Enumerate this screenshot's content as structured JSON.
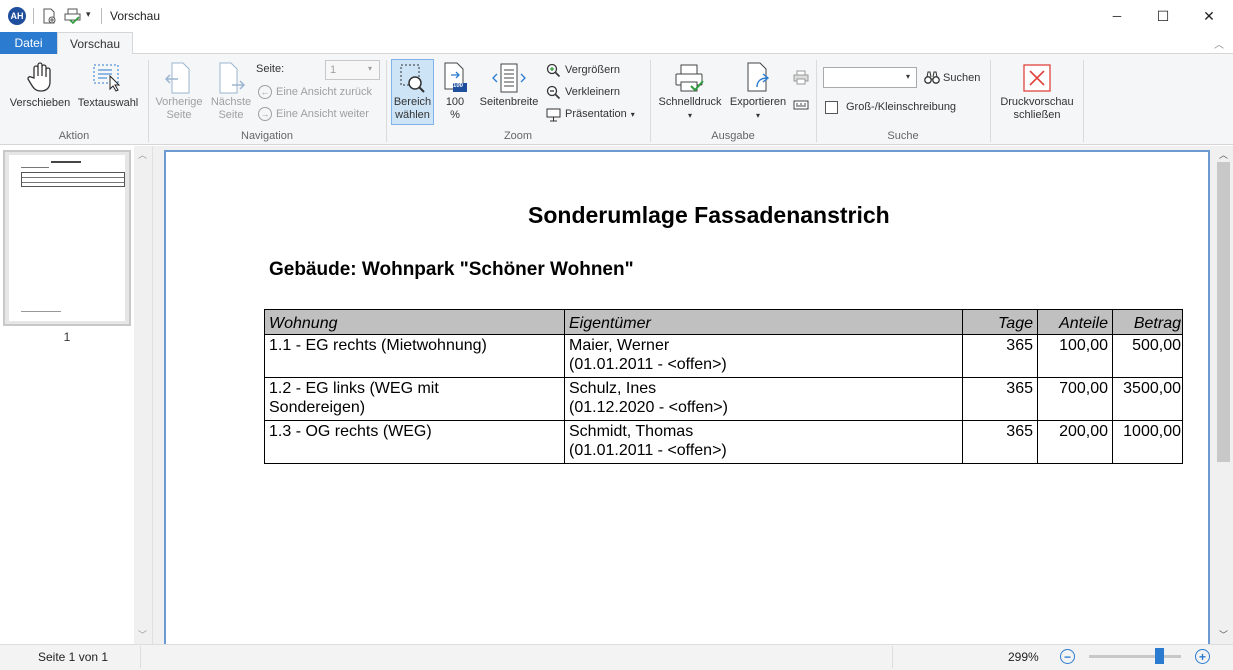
{
  "titlebar": {
    "avatar_initials": "AH",
    "title": "Vorschau",
    "minimize": "─",
    "maximize": "☐",
    "close": "✕"
  },
  "tabs": {
    "file": "Datei",
    "vorschau": "Vorschau"
  },
  "ribbon": {
    "aktion": {
      "label": "Aktion",
      "verschieben": "Verschieben",
      "textauswahl": "Textauswahl"
    },
    "navigation": {
      "label": "Navigation",
      "vorherige_line1": "Vorherige",
      "vorherige_line2": "Seite",
      "naechste_line1": "Nächste",
      "naechste_line2": "Seite",
      "seite_label": "Seite:",
      "seite_value": "1",
      "ansicht_zurueck": "Eine Ansicht zurück",
      "ansicht_weiter": "Eine Ansicht weiter"
    },
    "zoom": {
      "label": "Zoom",
      "bereich_line1": "Bereich",
      "bereich_line2": "wählen",
      "hundert_line1": "100",
      "hundert_line2": "%",
      "hundert_icon_text": "100",
      "seitenbreite": "Seitenbreite",
      "vergroessern": "Vergrößern",
      "verkleinern": "Verkleinern",
      "praesentation": "Präsentation"
    },
    "ausgabe": {
      "label": "Ausgabe",
      "schnelldruck": "Schnelldruck",
      "exportieren": "Exportieren"
    },
    "suche": {
      "label": "Suche",
      "suchen": "Suchen",
      "gross_klein": "Groß-/Kleinschreibung",
      "search_value": ""
    },
    "close_preview": {
      "line1": "Druckvorschau",
      "line2": "schließen"
    }
  },
  "thumbnail": {
    "page_number": "1"
  },
  "document": {
    "title": "Sonderumlage Fassadenanstrich",
    "subtitle": "Gebäude: Wohnpark \"Schöner Wohnen\"",
    "columns": [
      "Wohnung",
      "Eigentümer",
      "Tage",
      "Anteile",
      "Betrag"
    ],
    "rows": [
      {
        "wohnung": "1.1 - EG rechts (Mietwohnung)",
        "owner": "Maier, Werner",
        "period": "(01.01.2011 - <offen>)",
        "tage": "365",
        "anteile": "100,00",
        "betrag": "500,00"
      },
      {
        "wohnung": "1.2 - EG links (WEG mit Sondereigen)",
        "owner": "Schulz, Ines",
        "period": "(01.12.2020 - <offen>)",
        "tage": "365",
        "anteile": "700,00",
        "betrag": "3500,00"
      },
      {
        "wohnung": "1.3 - OG rechts (WEG)",
        "owner": "Schmidt, Thomas",
        "period": "(01.01.2011 - <offen>)",
        "tage": "365",
        "anteile": "200,00",
        "betrag": "1000,00"
      }
    ]
  },
  "statusbar": {
    "page_info": "Seite 1 von 1",
    "zoom": "299%",
    "zoom_level": 0.8
  },
  "colors": {
    "accent": "#2b7bd0",
    "selected_button_bg": "#cde4f7",
    "close_red": "#e0443e"
  }
}
